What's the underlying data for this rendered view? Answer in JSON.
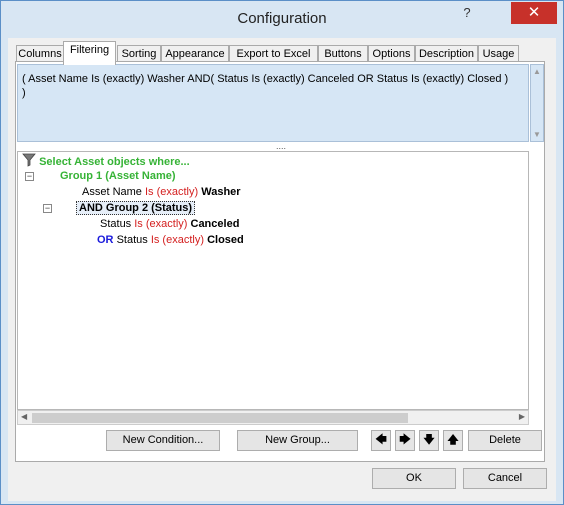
{
  "window": {
    "title": "Configuration",
    "help_label": "?",
    "close_label": "✕"
  },
  "tabs": [
    {
      "label": "Columns"
    },
    {
      "label": "Filtering"
    },
    {
      "label": "Sorting"
    },
    {
      "label": "Appearance"
    },
    {
      "label": "Export to Excel"
    },
    {
      "label": "Buttons"
    },
    {
      "label": "Options"
    },
    {
      "label": "Description"
    },
    {
      "label": "Usage"
    }
  ],
  "active_tab": "Filtering",
  "filter_expression": "( Asset Name Is (exactly) Washer AND( Status Is (exactly) Canceled OR Status Is (exactly) Closed ) )",
  "splitter_grip": "....",
  "tree": {
    "root": "Select Asset objects where...",
    "group1_label": "Group 1 (Asset Name)",
    "cond1": {
      "field": "Asset Name",
      "op": "Is (exactly)",
      "value": "Washer"
    },
    "group2_label": "AND Group 2 (Status)",
    "cond2": {
      "field": "Status",
      "op": "Is (exactly)",
      "value": "Canceled"
    },
    "cond3": {
      "connector": "OR",
      "field": "Status",
      "op": "Is (exactly)",
      "value": "Closed"
    }
  },
  "buttons": {
    "new_condition": "New Condition...",
    "new_group": "New Group...",
    "move_left": "🡄",
    "move_right": "🡆",
    "move_down": "🡇",
    "move_up": "🡅",
    "delete": "Delete",
    "ok": "OK",
    "cancel": "Cancel"
  },
  "colors": {
    "accent": "#5b8fc7",
    "close": "#c7312a",
    "green": "#36b336",
    "red": "#d42020",
    "blue": "#1a1adc"
  }
}
